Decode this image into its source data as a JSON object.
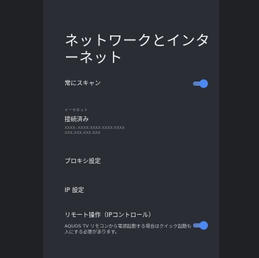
{
  "screen": {
    "title": "ネットワークとインターネット"
  },
  "items": {
    "always_scan": {
      "label": "常にスキャン",
      "toggle_on": true
    },
    "ethernet": {
      "section_header": "イーサネット",
      "status": "接続済み",
      "mac": "XXXX::XXXX:XXXX:XXXX:XXXX",
      "ip": "XXX.XXX.XXX.XXX"
    },
    "proxy": {
      "label": "プロキシ設定"
    },
    "ip_settings": {
      "label": "IP 設定"
    },
    "remote": {
      "label": "リモート操作（IPコントロール）",
      "description": "AQUOS TV リモコンから電源起動する場合はクイック起動も入にする必要があります。",
      "toggle_on": true
    }
  },
  "colors": {
    "accent": "#4b8af5",
    "background": "#2a2d33"
  }
}
